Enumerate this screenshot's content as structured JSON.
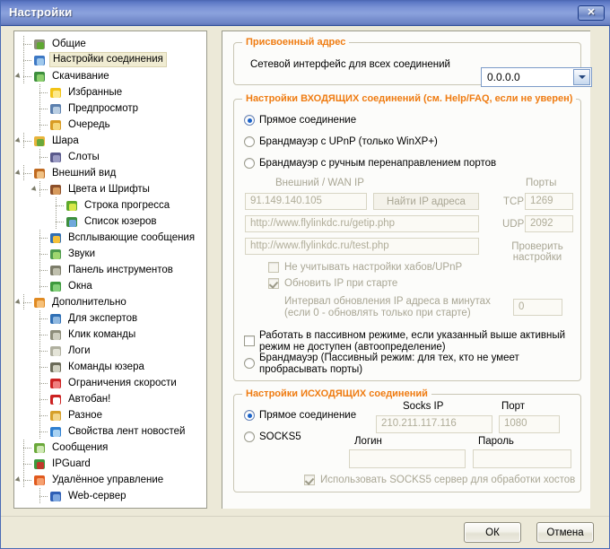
{
  "window": {
    "title": "Настройки",
    "close_label": "✕"
  },
  "tree": {
    "items": [
      {
        "label": "Общие",
        "depth": 0,
        "icon": "people-plus-icon",
        "expander": false,
        "selected": false
      },
      {
        "label": "Настройки соединения",
        "depth": 0,
        "icon": "globe-icon",
        "expander": false,
        "selected": true
      },
      {
        "label": "Скачивание",
        "depth": 0,
        "icon": "globe-download-icon",
        "expander": true,
        "selected": false
      },
      {
        "label": "Избранные",
        "depth": 1,
        "icon": "star-icon",
        "expander": false,
        "selected": false
      },
      {
        "label": "Предпросмотр",
        "depth": 1,
        "icon": "preview-icon",
        "expander": false,
        "selected": false
      },
      {
        "label": "Очередь",
        "depth": 1,
        "icon": "queue-icon",
        "expander": false,
        "selected": false
      },
      {
        "label": "Шара",
        "depth": 0,
        "icon": "share-folder-icon",
        "expander": true,
        "selected": false
      },
      {
        "label": "Слоты",
        "depth": 1,
        "icon": "bars-icon",
        "expander": false,
        "selected": false
      },
      {
        "label": "Внешний вид",
        "depth": 0,
        "icon": "appearance-icon",
        "expander": true,
        "selected": false
      },
      {
        "label": "Цвета и Шрифты",
        "depth": 1,
        "icon": "palette-icon",
        "expander": true,
        "selected": false
      },
      {
        "label": "Строка прогресса",
        "depth": 2,
        "icon": "progressbar-icon",
        "expander": false,
        "selected": false
      },
      {
        "label": "Список юзеров",
        "depth": 2,
        "icon": "users-icon",
        "expander": false,
        "selected": false
      },
      {
        "label": "Всплывающие сообщения",
        "depth": 1,
        "icon": "popup-icon",
        "expander": false,
        "selected": false
      },
      {
        "label": "Звуки",
        "depth": 1,
        "icon": "sound-icon",
        "expander": false,
        "selected": false
      },
      {
        "label": "Панель инструментов",
        "depth": 1,
        "icon": "toolbar-icon",
        "expander": false,
        "selected": false
      },
      {
        "label": "Окна",
        "depth": 1,
        "icon": "windows-icon",
        "expander": false,
        "selected": false
      },
      {
        "label": "Дополнительно",
        "depth": 0,
        "icon": "helmet-icon",
        "expander": true,
        "selected": false
      },
      {
        "label": "Для экспертов",
        "depth": 1,
        "icon": "expert-icon",
        "expander": false,
        "selected": false
      },
      {
        "label": "Клик команды",
        "depth": 1,
        "icon": "mouse-icon",
        "expander": false,
        "selected": false
      },
      {
        "label": "Логи",
        "depth": 1,
        "icon": "log-icon",
        "expander": false,
        "selected": false
      },
      {
        "label": "Команды юзера",
        "depth": 1,
        "icon": "book-icon",
        "expander": false,
        "selected": false
      },
      {
        "label": "Ограничения скорости",
        "depth": 1,
        "icon": "speedlimit-icon",
        "expander": false,
        "selected": false
      },
      {
        "label": "Автобан!",
        "depth": 1,
        "icon": "noentry-icon",
        "expander": false,
        "selected": false
      },
      {
        "label": "Разное",
        "depth": 1,
        "icon": "lock-icon",
        "expander": false,
        "selected": false
      },
      {
        "label": "Свойства лент новостей",
        "depth": 1,
        "icon": "rss-globe-icon",
        "expander": false,
        "selected": false
      },
      {
        "label": "Сообщения",
        "depth": 0,
        "icon": "check-icon",
        "expander": false,
        "selected": false
      },
      {
        "label": "IPGuard",
        "depth": 0,
        "icon": "shield-icon",
        "expander": false,
        "selected": false
      },
      {
        "label": "Удалённое управление",
        "depth": 0,
        "icon": "remote-icon",
        "expander": true,
        "selected": false
      },
      {
        "label": "Web-сервер",
        "depth": 1,
        "icon": "webserver-icon",
        "expander": false,
        "selected": false
      }
    ]
  },
  "assigned_address": {
    "legend": "Присвоенный адрес",
    "interface_label": "Сетевой интерфейс для всех соединений",
    "interface_value": "0.0.0.0"
  },
  "incoming": {
    "legend": "Настройки ВХОДЯЩИХ соединений (см. Help/FAQ, если не уверен)",
    "radios": [
      {
        "label": "Прямое соединение",
        "checked": true
      },
      {
        "label": "Брандмауэр с UPnP (только WinXP+)",
        "checked": false
      },
      {
        "label": "Брандмауэр с ручным перенаправлением портов",
        "checked": false
      }
    ],
    "wan_label": "Внешний / WAN IP",
    "ports_label": "Порты",
    "wan_ip": "91.149.140.105",
    "find_ip_button": "Найти IP адреса",
    "getip_url": "http://www.flylinkdc.ru/getip.php",
    "test_url": "http://www.flylinkdc.ru/test.php",
    "tcp_label": "TCP",
    "tcp_value": "1269",
    "udp_label": "UDP",
    "udp_value": "2092",
    "check_settings_button": "Проверить настройки",
    "ignore_hub_label": "Не учитывать настройки хабов/UPnP",
    "ignore_hub_checked": false,
    "update_ip_label": "Обновить IP при старте",
    "update_ip_checked": true,
    "interval_label": "Интервал обновления IP адреса в минутах (если 0 - обновлять только при старте)",
    "interval_value": "0",
    "passive_auto_label": "Работать в пассивном режиме, если указанный выше активный режим не доступен (автоопределение)",
    "passive_auto_checked": false,
    "passive_radio_label": "Брандмауэр (Пассивный режим: для тех, кто не умеет пробрасывать порты)",
    "passive_radio_checked": false
  },
  "outgoing": {
    "legend": "Настройки ИСХОДЯЩИХ соединений",
    "radios": [
      {
        "label": "Прямое соединение",
        "checked": true
      },
      {
        "label": "SOCKS5",
        "checked": false
      }
    ],
    "socks_ip_label": "Socks IP",
    "socks_ip_value": "210.211.117.116",
    "port_label": "Порт",
    "port_value": "1080",
    "login_label": "Логин",
    "login_value": "",
    "password_label": "Пароль",
    "password_value": "",
    "use_socks_label": "Использовать SOCKS5 сервер для обработки хостов",
    "use_socks_checked": true
  },
  "footer": {
    "ok_label": "ОК",
    "cancel_label": "Отмена"
  }
}
